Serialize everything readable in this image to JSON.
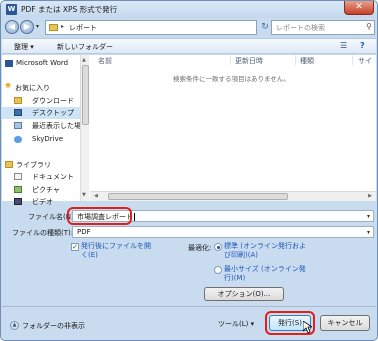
{
  "window": {
    "title": "PDF または XPS 形式で発行",
    "app_icon": "W",
    "close_glyph": "✕"
  },
  "nav": {
    "back_glyph": "◀",
    "forward_glyph": "▶",
    "dropdown_glyph": "▾",
    "address_sep": "▸",
    "address_crumb": "レポート",
    "refresh_glyph": "↻",
    "search_placeholder": "レポートの検索",
    "search_glyph": "⚲"
  },
  "toolbar": {
    "organize_label": "整理 ▾",
    "new_folder_label": "新しいフォルダー",
    "view_glyph": "☰",
    "help_glyph": "?"
  },
  "sidebar": {
    "items": [
      {
        "label": "Microsoft Word",
        "icon": "word-icon"
      },
      {
        "label": "お気に入り",
        "icon": "star-icon"
      },
      {
        "label": "ダウンロード",
        "icon": "download-folder-icon"
      },
      {
        "label": "デスクトップ",
        "icon": "desktop-icon"
      },
      {
        "label": "最近表示した場所",
        "icon": "recent-places-icon"
      },
      {
        "label": "SkyDrive",
        "icon": "skydrive-icon"
      },
      {
        "label": "ライブラリ",
        "icon": "library-icon"
      },
      {
        "label": "ドキュメント",
        "icon": "documents-icon"
      },
      {
        "label": "ピクチャ",
        "icon": "pictures-icon"
      },
      {
        "label": "ビデオ",
        "icon": "video-icon"
      }
    ]
  },
  "filelist": {
    "columns": [
      "名前",
      "更新日時",
      "種類",
      "サイ"
    ],
    "empty_message": "検索条件に一致する項目はありません。"
  },
  "form": {
    "filename_label": "ファイル名(N):",
    "filename_value": "市場調査レポート",
    "filetype_label": "ファイルの種類(T):",
    "filetype_value": "PDF",
    "open_after_publish": "発行後にファイルを開く(E)",
    "open_after_publish_checked": true,
    "optimize_label": "最適化:",
    "optimize_standard": "標準 (オンライン発行および印刷)(A)",
    "optimize_minimum": "最小サイズ (オンライン発行)(M)",
    "optimize_selected": "standard",
    "options_button": "オプション(O)..."
  },
  "footer": {
    "hide_folders": "フォルダーの非表示",
    "tools_label": "ツール(L)",
    "publish_button": "発行(S)",
    "cancel_button": "キャンセル"
  },
  "colors": {
    "highlight": "#e0201b",
    "frame": "#c9dcef",
    "link_blue": "#1f56b8"
  }
}
